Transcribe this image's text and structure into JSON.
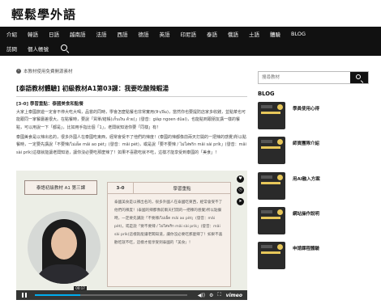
{
  "site": {
    "logo": "輕鬆學外語"
  },
  "nav": {
    "row1": [
      "介紹",
      "韓語",
      "日語",
      "越南語",
      "法語",
      "西語",
      "德語",
      "英語",
      "印尼語",
      "泰語",
      "俄語",
      "土語",
      "體驗",
      "BLOG"
    ],
    "row2": [
      "訪問",
      "個人帳號"
    ]
  },
  "notice": {
    "icon": "info-icon",
    "text": "本教材使用免費開源素材"
  },
  "article": {
    "title": "[泰語教材體驗] 初級教材A1第03課：我要吃酸辣蝦湯",
    "subtitle": "[3-0] 學習重點：泰國美食和點餐",
    "paragraph1": "大家上泰國旅遊一定會不停大吃大喝，品嘗的同時，學會怎麼點餐也非常實用(หิว/อิ่ม)，當然你也要提防店家多收錢，並點菜也可能跟同一家餐廳差很大。在點餐時，要說「買單/結帳(เก็บเงิน ด้วย)」(發音：giàp ngoen dûai)，也能點到跟朋友講一樣的餐點，可以用說一下「都是」，比如用手指比個「1」，老闆就知道你要「同樣」有！",
    "paragraph2": "泰國美食是以辣出名的，很多外國人在泰國吃東西，經常會受不了他們的辣度！(泰國的辣都像前兩天打開的一把辣的感覺)所以點餐時，一定要先講說「不要辣/ไม่เผ็ด mâi ao pèt」(發音：mâi pèt)，或是說「要不要辣 / ไม่ใส่พริก mâi sài prík」(發音：mâi sài prík)這樣就能讓老闆知道，讓你沒必要吃那麼辣了！如果不喜歡吃就不吃，這樣才能享受到泰國的「美食」！"
  },
  "video": {
    "title_box": "泰語初級教材 A1 第三課",
    "card_number": "3-0",
    "card_title": "學習重點",
    "card_text": "泰國美食是以辣出名的，很多外國人在泰國吃東西，經常會受不了他們的辣度！(泰國的辣都像前兩天打開的一把辣的感覺)所以點餐時，一定要先講說「不要辣/ไม่เผ็ด mâi ao pèt」(發音：mâi pèt)，或是說「要不要辣 / ไม่ใส่พริก mâi sài prík」(發音：mâi sài prík)這樣就能讓老闆知道，讓你沒必要吃那麼辣了！如果不喜歡吃就不吃，這樣才能享受到泰國的「美食」！",
    "side_icons": [
      "heart-icon",
      "clock-icon",
      "send-icon"
    ],
    "time": "00:17",
    "progress": 0.3,
    "brand": "vimeo"
  },
  "sidebar": {
    "search_placeholder": "搜尋教材",
    "blog_heading": "BLOG",
    "posts": [
      {
        "label": "學員使用心得"
      },
      {
        "label": "師資團隊介紹"
      },
      {
        "label": "用AI融入方案"
      },
      {
        "label": "網站操作說明"
      },
      {
        "label": "申請課程體驗"
      }
    ]
  }
}
